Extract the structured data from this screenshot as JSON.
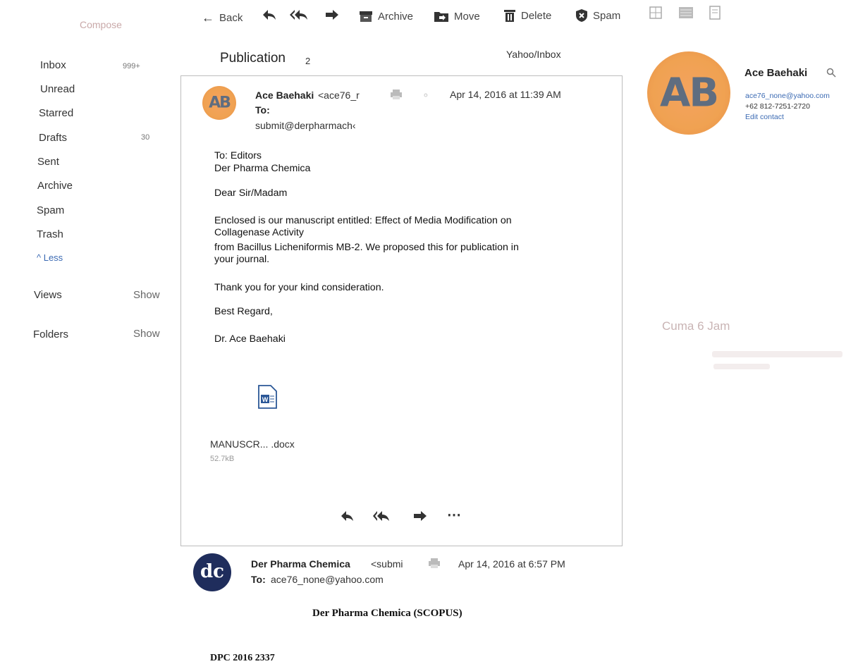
{
  "compose_label": "Compose",
  "toolbar": {
    "back": "Back",
    "archive": "Archive",
    "move": "Move",
    "delete": "Delete",
    "spam": "Spam"
  },
  "sidebar": {
    "items": [
      {
        "label": "Inbox",
        "count": "999+"
      },
      {
        "label": "Unread",
        "count": ""
      },
      {
        "label": "Starred",
        "count": ""
      },
      {
        "label": "Drafts",
        "count": "30"
      },
      {
        "label": "Sent",
        "count": ""
      },
      {
        "label": "Archive",
        "count": ""
      },
      {
        "label": "Spam",
        "count": ""
      },
      {
        "label": "Trash",
        "count": ""
      }
    ],
    "less_label": "^ Less",
    "views_label": "Views",
    "views_show": "Show",
    "folders_label": "Folders",
    "folders_show": "Show"
  },
  "thread": {
    "subject": "Publication",
    "count": "2",
    "location": "Yahoo/Inbox"
  },
  "message1": {
    "avatar_initials": "AB",
    "sender_name": "Ace Baehaki",
    "sender_email_truncated": "<ace76_r",
    "date": "Apr 14, 2016 at 11:39 AM",
    "to_label": "To:",
    "to_value": "submit@derpharmach‹",
    "body": {
      "line1": "To: Editors",
      "line2": "Der Pharma Chemica",
      "greeting": "Dear Sir/Madam",
      "para1_line1": "Enclosed is our manuscript entitled: Effect of Media Modification on",
      "para1_line2": "Collagenase Activity",
      "para1_line3": "from Bacillus Licheniformis MB-2. We proposed this for publication in",
      "para1_line4": "your journal.",
      "thanks": "Thank you for your kind consideration.",
      "closing": "Best Regard,",
      "signature": "Dr. Ace Baehaki"
    },
    "attachment": {
      "name": "MANUSCR... .docx",
      "size": "52.7kB"
    }
  },
  "message2": {
    "avatar_initials": "dc",
    "sender_name": "Der Pharma Chemica",
    "sender_email_truncated": "<submi",
    "date": "Apr 14, 2016 at 6:57 PM",
    "to_label": "To:",
    "to_value": "ace76_none@yahoo.com",
    "heading": "Der Pharma Chemica (SCOPUS)",
    "ref_partial": "DPC 2016 2337"
  },
  "contact": {
    "avatar_initials": "AB",
    "name": "Ace Baehaki",
    "email": "ace76_none@yahoo.com",
    "phone": "+62 812-7251-2720",
    "edit_label": "Edit contact"
  },
  "ad": {
    "headline": "Cuma 6 Jam"
  },
  "colors": {
    "link": "#3b6ab3",
    "avatar_orange": "#f0a252",
    "avatar_navy": "#1f2d5c",
    "card_border": "#bdbdbd"
  }
}
